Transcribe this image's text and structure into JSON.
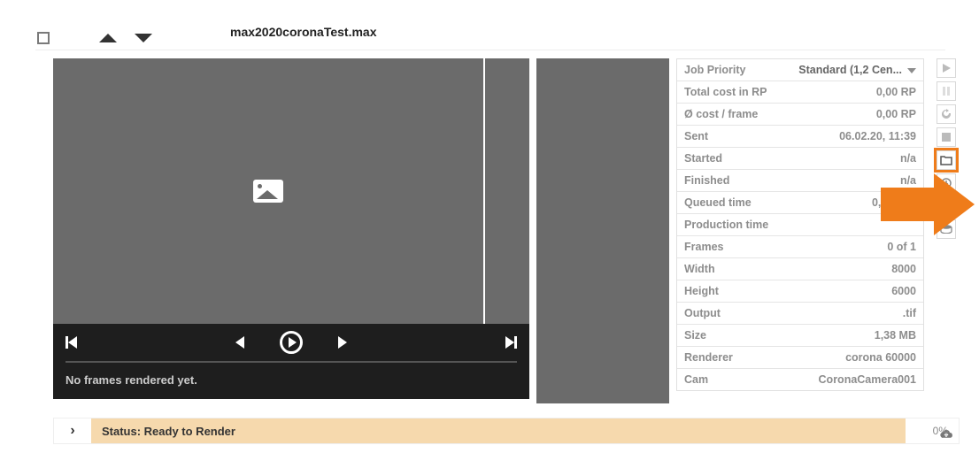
{
  "header": {
    "filename": "max2020coronaTest.max"
  },
  "player": {
    "status": "No frames rendered yet."
  },
  "info_rows": [
    {
      "label": "Job Priority",
      "value": "Standard (1,2 Cen...",
      "dropdown": true
    },
    {
      "label": "Total cost in RP",
      "value": "0,00 RP"
    },
    {
      "label": "Ø cost / frame",
      "value": "0,00 RP"
    },
    {
      "label": "Sent",
      "value": "06.02.20, 11:39"
    },
    {
      "label": "Started",
      "value": "n/a"
    },
    {
      "label": "Finished",
      "value": "n/a"
    },
    {
      "label": "Queued time",
      "value": "0,00 min"
    },
    {
      "label": "Production time",
      "value": ""
    },
    {
      "label": "Frames",
      "value": "0 of 1"
    },
    {
      "label": "Width",
      "value": "8000"
    },
    {
      "label": "Height",
      "value": "6000"
    },
    {
      "label": "Output",
      "value": ".tif"
    },
    {
      "label": "Size",
      "value": "1,38 MB"
    },
    {
      "label": "Renderer",
      "value": "corona 60000"
    },
    {
      "label": "Cam",
      "value": "CoronaCamera001"
    }
  ],
  "toolbar": [
    {
      "name": "play-icon"
    },
    {
      "name": "pause-icon"
    },
    {
      "name": "refresh-icon"
    },
    {
      "name": "stop-icon"
    },
    {
      "name": "open-folder-icon",
      "highlight": true
    },
    {
      "name": "schedule-icon"
    },
    {
      "name": "cloud-icon"
    },
    {
      "name": "disk-icon"
    }
  ],
  "bottom": {
    "status_label": "Status: Ready to Render",
    "percent": "0%"
  }
}
